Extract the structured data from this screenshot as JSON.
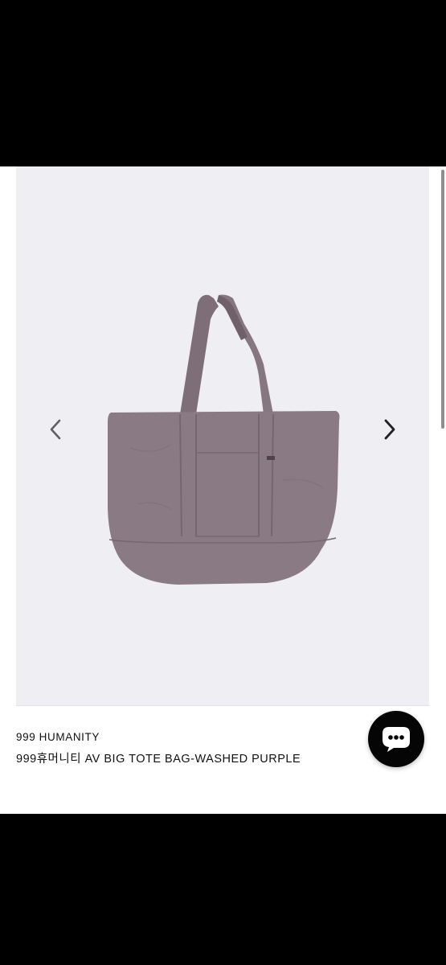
{
  "product": {
    "brand": "999 HUMANITY",
    "name": "999휴머니티 AV BIG TOTE BAG-WASHED PURPLE"
  },
  "gallery": {
    "image_subject": "tote-bag",
    "background_color": "#efeef2",
    "bag_color": "#8a7a84",
    "prev_icon": "chevron-left-icon",
    "next_icon": "chevron-right-icon"
  },
  "chat": {
    "icon": "chat-bubble-icon",
    "color": "#050505"
  }
}
